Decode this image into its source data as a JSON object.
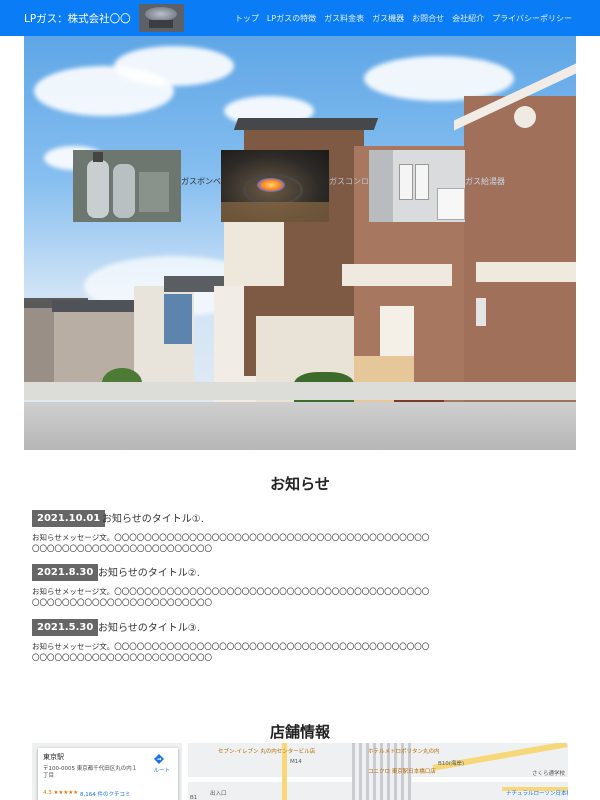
{
  "header": {
    "brand": "LPガス：株式会社〇〇",
    "nav": [
      "トップ",
      "LPガスの特徴",
      "ガス料金表",
      "ガス機器",
      "お問合せ",
      "会社紹介",
      "プライバシーポリシー"
    ]
  },
  "hero": {
    "captions": [
      "ガスボンベ",
      "ガスコンロ",
      "ガス給湯器"
    ]
  },
  "news": {
    "title": "お知らせ",
    "items": [
      {
        "date": "2021.10.01",
        "title": "お知らせのタイトル①.",
        "message": "お知らせメッセージ文。〇〇〇〇〇〇〇〇〇〇〇〇〇〇〇〇〇〇〇〇〇〇〇〇〇〇〇〇〇〇〇〇〇〇〇〇〇〇〇〇〇〇〇〇〇〇〇〇〇〇〇〇〇〇〇〇〇〇〇〇〇〇〇〇〇〇"
      },
      {
        "date": "2021.8.30",
        "title": "お知らせのタイトル②.",
        "message": "お知らせメッセージ文。〇〇〇〇〇〇〇〇〇〇〇〇〇〇〇〇〇〇〇〇〇〇〇〇〇〇〇〇〇〇〇〇〇〇〇〇〇〇〇〇〇〇〇〇〇〇〇〇〇〇〇〇〇〇〇〇〇〇〇〇〇〇〇〇〇〇"
      },
      {
        "date": "2021.5.30",
        "title": "お知らせのタイトル③.",
        "message": "お知らせメッセージ文。〇〇〇〇〇〇〇〇〇〇〇〇〇〇〇〇〇〇〇〇〇〇〇〇〇〇〇〇〇〇〇〇〇〇〇〇〇〇〇〇〇〇〇〇〇〇〇〇〇〇〇〇〇〇〇〇〇〇〇〇〇〇〇〇〇〇"
      }
    ]
  },
  "store": {
    "title": "店舗情報",
    "map": {
      "place_name": "東京駅",
      "address": "〒100-0005 東京都千代田区丸の内１丁目",
      "rating": "4.3 ★★★★★",
      "reviews": "8,164 件のクチコミ",
      "route_label": "ルート",
      "labels": [
        "セブン-イレブン 丸の内センタービル店",
        "ホテルメトロポリタン丸の内",
        "コニクロ 東京駅日本橋口店",
        "B10(海岸)",
        "M14",
        "さくら通学校",
        "ナチュラルローソン日本橋二丁目店",
        "出入口",
        "B1"
      ]
    }
  }
}
